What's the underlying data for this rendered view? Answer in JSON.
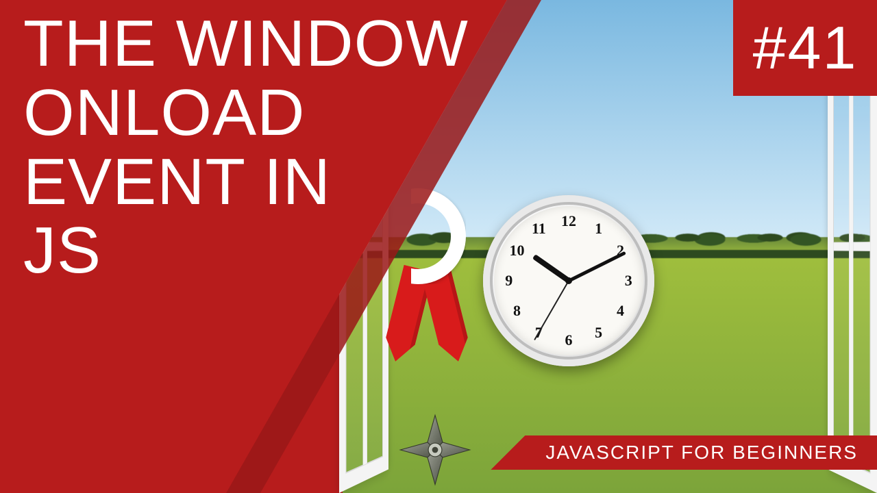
{
  "title_lines": [
    "THE WINDOW",
    "ONLOAD",
    "EVENT IN",
    "JS"
  ],
  "episode_badge": "#41",
  "series_label": "JAVASCRIPT FOR BEGINNERS",
  "clock": {
    "numerals": [
      "12",
      "1",
      "2",
      "3",
      "4",
      "5",
      "6",
      "7",
      "8",
      "9",
      "10",
      "11"
    ],
    "hour": 10,
    "minute": 10,
    "second": 35
  },
  "colors": {
    "red": "#b71c1c",
    "red_dark": "#9a1818"
  }
}
